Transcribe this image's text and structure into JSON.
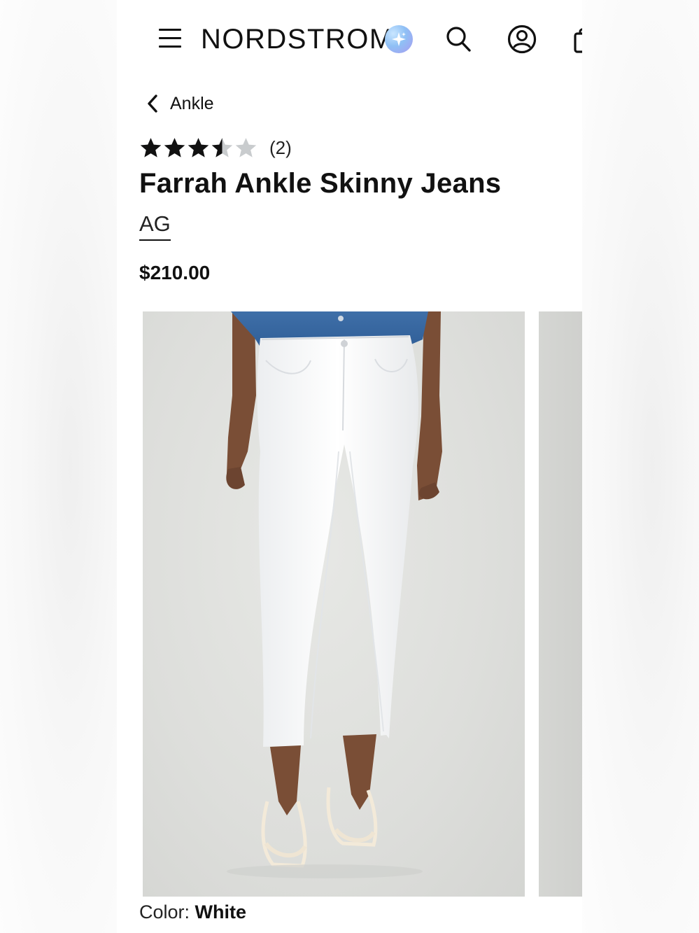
{
  "header": {
    "brand_logo": "NORDSTROM",
    "icons": [
      "menu-icon",
      "sparkle-icon",
      "search-icon",
      "account-icon",
      "shopping-bag-icon"
    ]
  },
  "breadcrumb": {
    "back_label": "Ankle"
  },
  "product": {
    "rating_value": 3.5,
    "rating_max": 5,
    "review_count": "(2)",
    "title": "Farrah Ankle Skinny Jeans",
    "brand": "AG",
    "price": "$210.00",
    "color_label": "Color:",
    "color_value": "White"
  },
  "colors": {
    "text": "#111111",
    "star_filled": "#111111",
    "star_empty": "#c9ccce",
    "image_bg": "#dddedb"
  }
}
